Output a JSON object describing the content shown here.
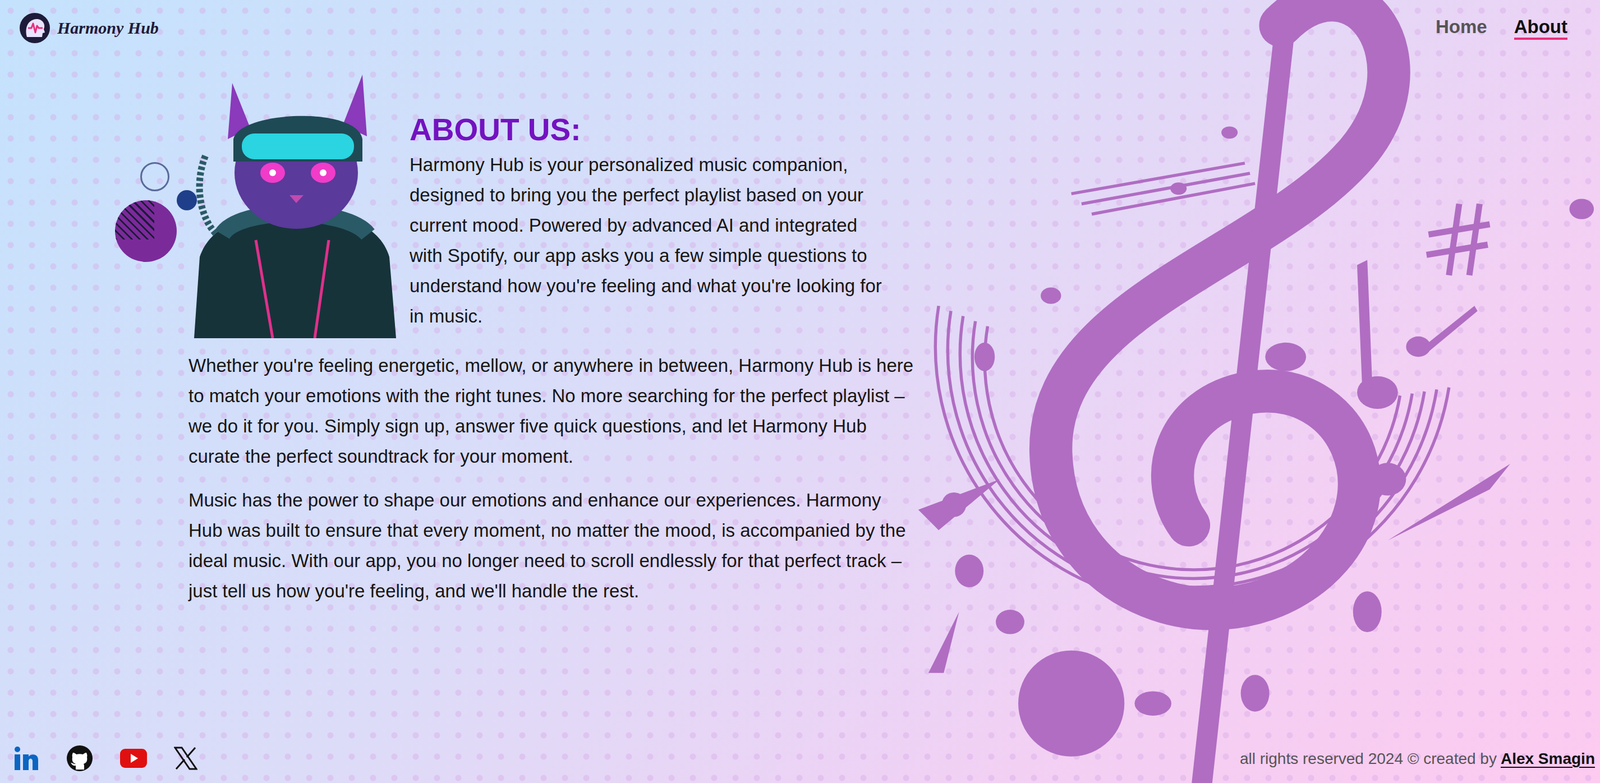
{
  "brand": {
    "name": "Harmony Hub"
  },
  "nav": [
    {
      "label": "Home",
      "selected": false
    },
    {
      "label": "About",
      "selected": true
    }
  ],
  "about": {
    "heading": "ABOUT US:",
    "intro": "Harmony Hub is your personalized music companion, designed to bring you the perfect playlist based on your current mood. Powered by advanced AI and integrated with Spotify, our app asks you a few simple questions to understand how you're feeling and what you're looking for in music.",
    "paragraphs": [
      "Whether you're feeling energetic, mellow, or anywhere in between, Harmony Hub is here to match your emotions with the right tunes. No more searching for the perfect playlist – we do it for you. Simply sign up, answer five quick questions, and let Harmony Hub curate the perfect soundtrack for your moment.",
      "Music has the power to shape our emotions and enhance our experiences. Harmony Hub was built to ensure that every moment, no matter the mood, is accompanied by the ideal music. With our app, you no longer need to scroll endlessly for that perfect track – just tell us how you're feeling, and we'll handle the rest."
    ]
  },
  "footer": {
    "text": "all rights reserved 2024 © created by",
    "author": "Alex Smagin"
  }
}
